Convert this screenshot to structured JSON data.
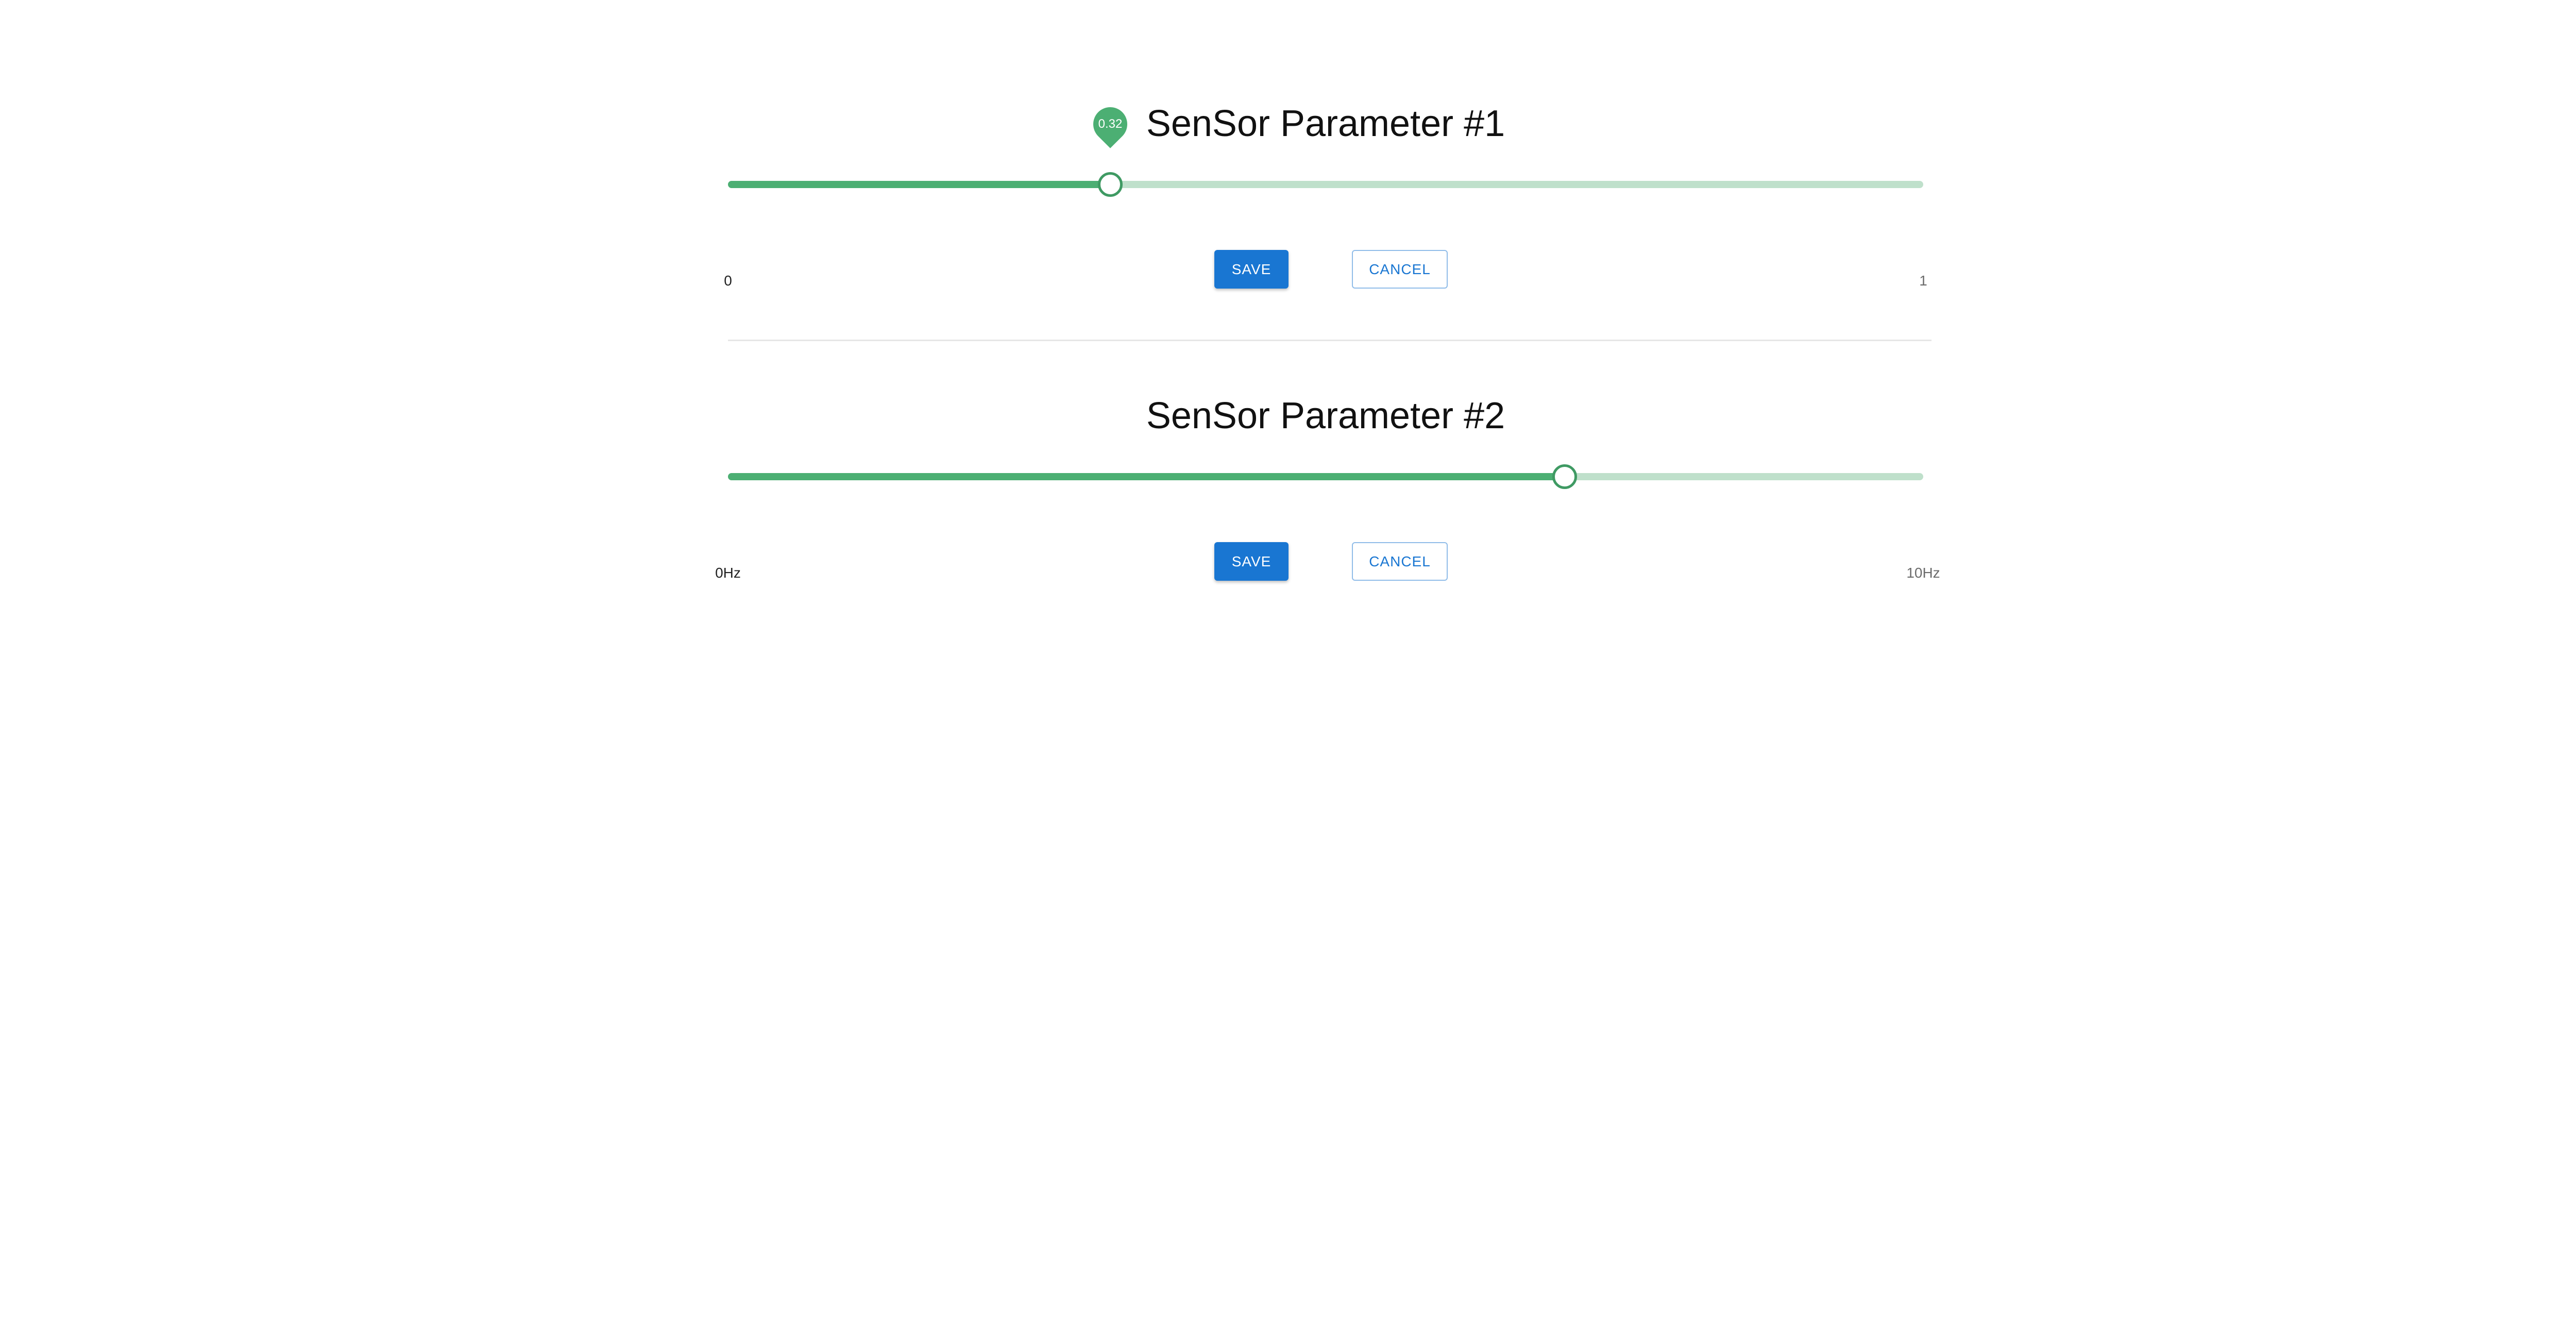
{
  "parameters": [
    {
      "title": "SenSor Parameter #1",
      "min_label": "0",
      "max_label": "1",
      "min": 0,
      "max": 1,
      "value": 0.32,
      "value_label": "0.32",
      "save_label": "SAVE",
      "cancel_label": "CANCEL"
    },
    {
      "title": "SenSor Parameter #2",
      "min_label": "0Hz",
      "max_label": "10Hz",
      "min": 0,
      "max": 10,
      "value": 7,
      "save_label": "SAVE",
      "cancel_label": "CANCEL"
    }
  ],
  "colors": {
    "slider_track": "#4caf73",
    "slider_rail": "#bfe0cb",
    "primary": "#1976d2"
  }
}
